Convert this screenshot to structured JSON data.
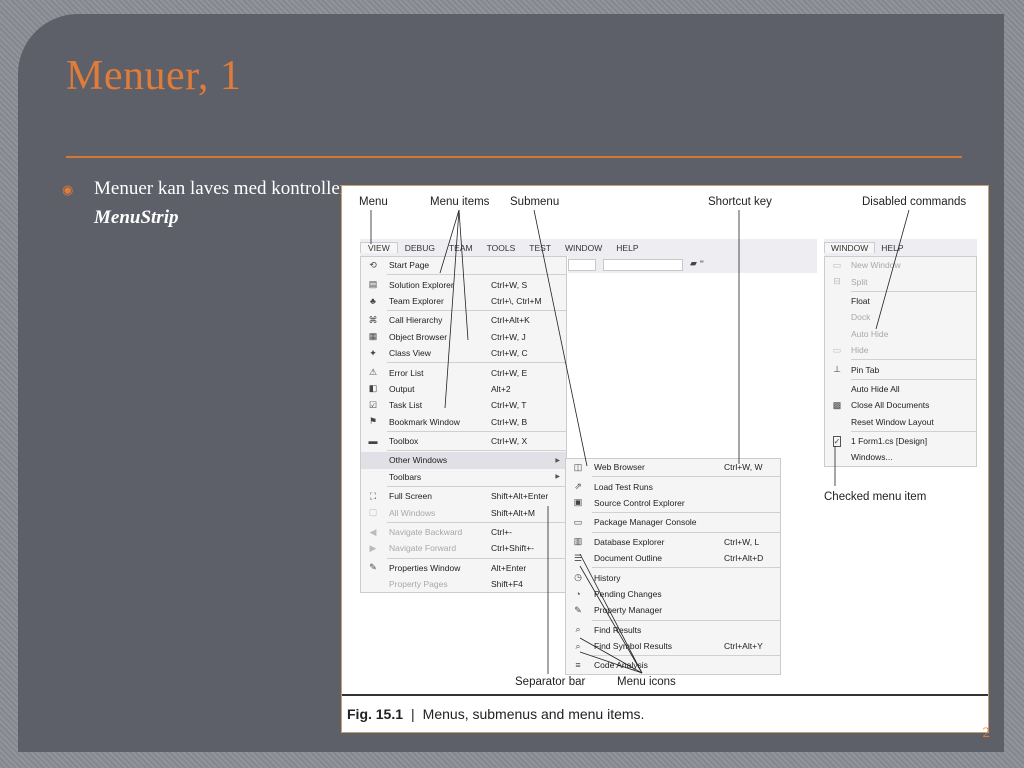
{
  "slide": {
    "title": "Menuer, 1",
    "bullet_prefix": "Menuer kan laves med kontrollen ",
    "bullet_emph": "MenuStrip",
    "page_number": "2",
    "accent_color": "#e07b3a"
  },
  "figure": {
    "callouts": {
      "menu": "Menu",
      "menu_items": "Menu items",
      "submenu": "Submenu",
      "shortcut_key": "Shortcut key",
      "disabled_commands": "Disabled commands",
      "checked_menu_item": "Checked menu item",
      "separator_bar": "Separator bar",
      "menu_icons": "Menu icons"
    },
    "caption_num": "Fig. 15.1",
    "caption_sep": "|",
    "caption_text": "Menus, submenus and menu items.",
    "menubar": [
      "VIEW",
      "DEBUG",
      "TEAM",
      "TOOLS",
      "TEST",
      "WINDOW",
      "HELP"
    ],
    "view_menu": [
      {
        "icon": "start-page-icon",
        "label": "Start Page",
        "shortcut": ""
      },
      {
        "icon": "solution-explorer-icon",
        "label": "Solution Explorer",
        "shortcut": "Ctrl+W, S"
      },
      {
        "icon": "team-explorer-icon",
        "label": "Team Explorer",
        "shortcut": "Ctrl+\\, Ctrl+M"
      },
      {
        "icon": "call-hierarchy-icon",
        "label": "Call Hierarchy",
        "shortcut": "Ctrl+Alt+K"
      },
      {
        "icon": "object-browser-icon",
        "label": "Object Browser",
        "shortcut": "Ctrl+W, J"
      },
      {
        "icon": "class-view-icon",
        "label": "Class View",
        "shortcut": "Ctrl+W, C"
      },
      {
        "icon": "error-list-icon",
        "label": "Error List",
        "shortcut": "Ctrl+W, E"
      },
      {
        "icon": "output-icon",
        "label": "Output",
        "shortcut": "Alt+2"
      },
      {
        "icon": "task-list-icon",
        "label": "Task List",
        "shortcut": "Ctrl+W, T"
      },
      {
        "icon": "bookmark-window-icon",
        "label": "Bookmark Window",
        "shortcut": "Ctrl+W, B"
      },
      {
        "icon": "toolbox-icon",
        "label": "Toolbox",
        "shortcut": "Ctrl+W, X"
      },
      {
        "icon": "",
        "label": "Other Windows",
        "shortcut": "",
        "submenu": true
      },
      {
        "icon": "",
        "label": "Toolbars",
        "shortcut": "",
        "submenu": true
      },
      {
        "icon": "full-screen-icon",
        "label": "Full Screen",
        "shortcut": "Shift+Alt+Enter"
      },
      {
        "icon": "all-windows-icon",
        "label": "All Windows",
        "shortcut": "Shift+Alt+M",
        "disabled": true
      },
      {
        "icon": "navigate-backward-icon",
        "label": "Navigate Backward",
        "shortcut": "Ctrl+-",
        "disabled": true
      },
      {
        "icon": "navigate-forward-icon",
        "label": "Navigate Forward",
        "shortcut": "Ctrl+Shift+-",
        "disabled": true
      },
      {
        "icon": "properties-window-icon",
        "label": "Properties Window",
        "shortcut": "Alt+Enter"
      },
      {
        "icon": "",
        "label": "Property Pages",
        "shortcut": "Shift+F4",
        "disabled": true
      }
    ],
    "other_windows_menu": [
      {
        "icon": "web-browser-icon",
        "label": "Web Browser",
        "shortcut": "Ctrl+W, W"
      },
      {
        "icon": "load-test-runs-icon",
        "label": "Load Test Runs",
        "shortcut": ""
      },
      {
        "icon": "source-control-explorer-icon",
        "label": "Source Control Explorer",
        "shortcut": ""
      },
      {
        "icon": "package-manager-console-icon",
        "label": "Package Manager Console",
        "shortcut": ""
      },
      {
        "icon": "database-explorer-icon",
        "label": "Database Explorer",
        "shortcut": "Ctrl+W, L"
      },
      {
        "icon": "document-outline-icon",
        "label": "Document Outline",
        "shortcut": "Ctrl+Alt+D"
      },
      {
        "icon": "history-icon",
        "label": "History",
        "shortcut": ""
      },
      {
        "icon": "pending-changes-icon",
        "label": "Pending Changes",
        "shortcut": ""
      },
      {
        "icon": "property-manager-icon",
        "label": "Property Manager",
        "shortcut": ""
      },
      {
        "icon": "find-results-icon",
        "label": "Find Results",
        "shortcut": ""
      },
      {
        "icon": "find-symbol-results-icon",
        "label": "Find Symbol Results",
        "shortcut": "Ctrl+Alt+Y"
      },
      {
        "icon": "code-analysis-icon",
        "label": "Code Analysis",
        "shortcut": ""
      }
    ],
    "window_menubar": [
      "WINDOW",
      "HELP"
    ],
    "window_menu": [
      {
        "icon": "new-window-icon",
        "label": "New Window",
        "disabled": true
      },
      {
        "icon": "split-icon",
        "label": "Split",
        "disabled": true
      },
      {
        "icon": "",
        "label": "Float"
      },
      {
        "icon": "",
        "label": "Dock",
        "disabled": true
      },
      {
        "icon": "",
        "label": "Auto Hide",
        "disabled": true
      },
      {
        "icon": "hide-icon",
        "label": "Hide",
        "disabled": true
      },
      {
        "icon": "pin-icon",
        "label": "Pin Tab"
      },
      {
        "icon": "",
        "label": "Auto Hide All"
      },
      {
        "icon": "close-all-documents-icon",
        "label": "Close All Documents"
      },
      {
        "icon": "",
        "label": "Reset Window Layout"
      },
      {
        "icon": "checkmark-icon",
        "label": "1 Form1.cs [Design]",
        "checked": true
      },
      {
        "icon": "",
        "label": "Windows..."
      }
    ]
  }
}
